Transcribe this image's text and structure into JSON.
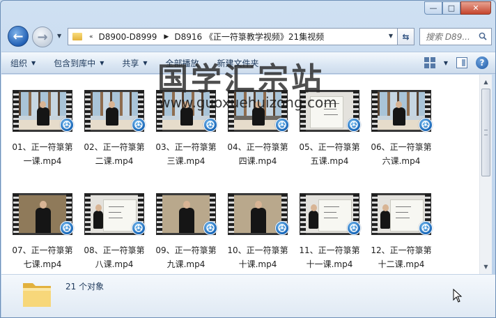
{
  "window": {
    "caption_buttons": [
      "—",
      "□",
      "✕"
    ]
  },
  "navigation": {
    "back_icon": "back-arrow-icon",
    "forward_icon": "forward-arrow-icon",
    "overflow_marker": "«",
    "breadcrumbs": [
      "D8900-D8999",
      "D8916 《正一符箓教学视频》21集视频"
    ],
    "search_placeholder": "搜索 D89..."
  },
  "toolbar": {
    "items": [
      {
        "label": "组织",
        "has_dropdown": true
      },
      {
        "label": "包含到库中",
        "has_dropdown": true
      },
      {
        "label": "共享",
        "has_dropdown": true
      },
      {
        "label": "全部播放",
        "has_dropdown": false
      },
      {
        "label": "新建文件夹",
        "has_dropdown": false
      }
    ],
    "help_label": "?"
  },
  "files": [
    {
      "line1": "01、正一符箓第",
      "line2": "一课.mp4"
    },
    {
      "line1": "02、正一符箓第",
      "line2": "二课.mp4"
    },
    {
      "line1": "03、正一符箓第",
      "line2": "三课.mp4"
    },
    {
      "line1": "04、正一符箓第",
      "line2": "四课.mp4"
    },
    {
      "line1": "05、正一符箓第",
      "line2": "五课.mp4"
    },
    {
      "line1": "06、正一符箓第",
      "line2": "六课.mp4"
    },
    {
      "line1": "07、正一符箓第",
      "line2": "七课.mp4"
    },
    {
      "line1": "08、正一符箓第",
      "line2": "八课.mp4"
    },
    {
      "line1": "09、正一符箓第",
      "line2": "九课.mp4"
    },
    {
      "line1": "10、正一符箓第",
      "line2": "十课.mp4"
    },
    {
      "line1": "11、正一符箓第",
      "line2": "十一课.mp4"
    },
    {
      "line1": "12、正一符箓第",
      "line2": "十二课.mp4"
    }
  ],
  "watermark": {
    "title": "国学汇宗站",
    "url": "www.guoxuehuizong.com"
  },
  "status": {
    "item_count": "21 个对象"
  },
  "colors": {
    "accent": "#1967b8",
    "toolbar_text": "#1e395b"
  }
}
